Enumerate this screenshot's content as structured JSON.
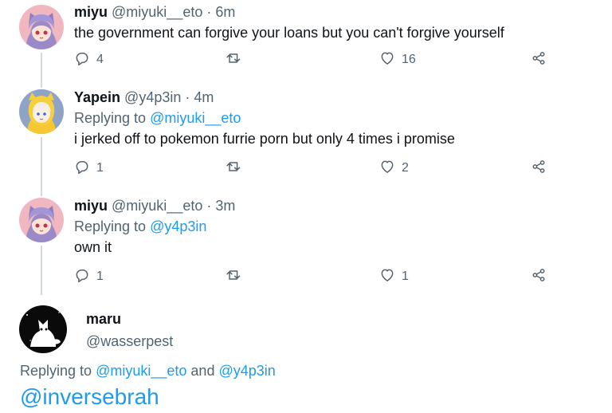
{
  "tweets": [
    {
      "name": "miyu",
      "handle": "@miyuki__eto",
      "time": "6m",
      "replying_label": "",
      "replying_to": "",
      "text": "the government can forgive your loans but you can't forgive yourself",
      "replies": "4",
      "retweets": "",
      "likes": "16"
    },
    {
      "name": "Yapein",
      "handle": "@y4p3in",
      "time": "4m",
      "replying_label": "Replying to",
      "replying_to": "@miyuki__eto",
      "text": "i jerked off to pokemon furrie porn but only 4 times i promise",
      "replies": "1",
      "retweets": "",
      "likes": "2"
    },
    {
      "name": "miyu",
      "handle": "@miyuki__eto",
      "time": "3m",
      "replying_label": "Replying to",
      "replying_to": "@y4p3in",
      "text": "own it",
      "replies": "1",
      "retweets": "",
      "likes": "1"
    }
  ],
  "main_tweet": {
    "name": "maru",
    "handle": "@wasserpest",
    "replying_label": "Replying to",
    "replying_to_1": "@miyuki__eto",
    "and_label": "and",
    "replying_to_2": "@y4p3in",
    "text": "@inversebrah"
  },
  "separator": "·",
  "icons": {
    "reply": "reply-icon",
    "retweet": "retweet-icon",
    "like": "heart-icon",
    "share": "share-icon"
  },
  "colors": {
    "text": "#0f1419",
    "secondary": "#536471",
    "link": "#1d9bf0",
    "thread_line": "#cfd9de"
  }
}
